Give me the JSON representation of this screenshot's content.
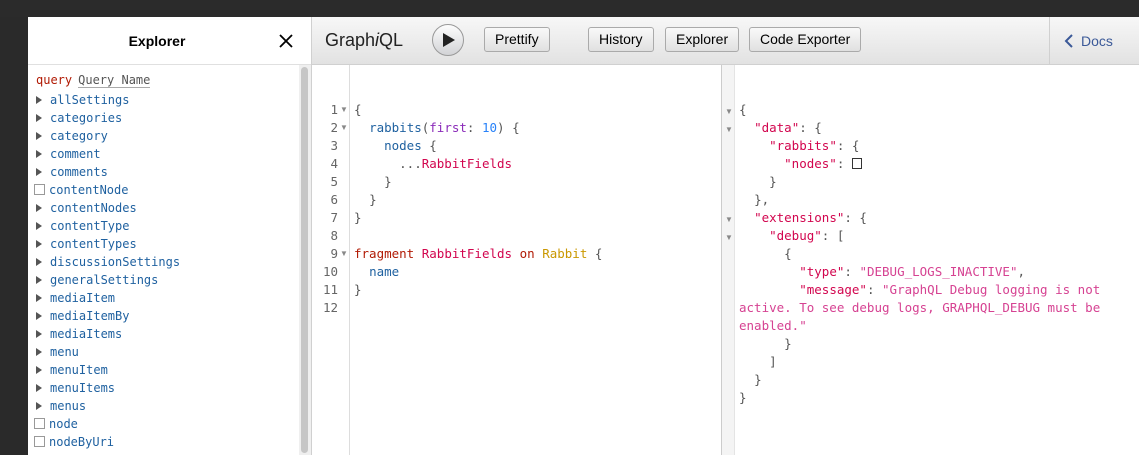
{
  "explorer": {
    "title": "Explorer",
    "query_keyword": "query",
    "query_name": "Query Name",
    "fields": [
      {
        "name": "allSettings",
        "kind": "object"
      },
      {
        "name": "categories",
        "kind": "object"
      },
      {
        "name": "category",
        "kind": "object"
      },
      {
        "name": "comment",
        "kind": "object"
      },
      {
        "name": "comments",
        "kind": "object"
      },
      {
        "name": "contentNode",
        "kind": "checkbox"
      },
      {
        "name": "contentNodes",
        "kind": "object"
      },
      {
        "name": "contentType",
        "kind": "object"
      },
      {
        "name": "contentTypes",
        "kind": "object"
      },
      {
        "name": "discussionSettings",
        "kind": "object"
      },
      {
        "name": "generalSettings",
        "kind": "object"
      },
      {
        "name": "mediaItem",
        "kind": "object"
      },
      {
        "name": "mediaItemBy",
        "kind": "object"
      },
      {
        "name": "mediaItems",
        "kind": "object"
      },
      {
        "name": "menu",
        "kind": "object"
      },
      {
        "name": "menuItem",
        "kind": "object"
      },
      {
        "name": "menuItems",
        "kind": "object"
      },
      {
        "name": "menus",
        "kind": "object"
      },
      {
        "name": "node",
        "kind": "checkbox"
      },
      {
        "name": "nodeByUri",
        "kind": "checkbox"
      }
    ]
  },
  "toolbar": {
    "title_prefix": "Graph",
    "title_i": "i",
    "title_suffix": "QL",
    "buttons": [
      "Prettify",
      "History",
      "Explorer",
      "Code Exporter"
    ],
    "docs": "Docs"
  },
  "query_editor": {
    "line_numbers": [
      "1",
      "2",
      "3",
      "4",
      "5",
      "6",
      "7",
      "8",
      "9",
      "10",
      "11",
      "12"
    ],
    "tokens": {
      "open_brace": "{",
      "close_brace": "}",
      "rabbits": "rabbits",
      "paren_open": "(",
      "first_arg": "first",
      "colon": ": ",
      "first_val": "10",
      "paren_close_brace": ") {",
      "nodes": "nodes",
      "brace_after_nodes": " {",
      "spread": "...",
      "fragment_ref": "RabbitFields",
      "fragment_kw": "fragment",
      "fragment_name": "RabbitFields",
      "on_kw": "on",
      "type_name": "Rabbit",
      "name_field": "name"
    }
  },
  "result": {
    "data_key": "\"data\"",
    "rabbits_key": "\"rabbits\"",
    "nodes_key": "\"nodes\"",
    "extensions_key": "\"extensions\"",
    "debug_key": "\"debug\"",
    "type_key": "\"type\"",
    "type_val": "\"DEBUG_LOGS_INACTIVE\"",
    "message_key": "\"message\"",
    "message_val_1": "\"GraphQL Debug logging is not",
    "message_val_2": "active. To see debug logs, GRAPHQL_DEBUG must be",
    "message_val_3": "enabled.\""
  }
}
